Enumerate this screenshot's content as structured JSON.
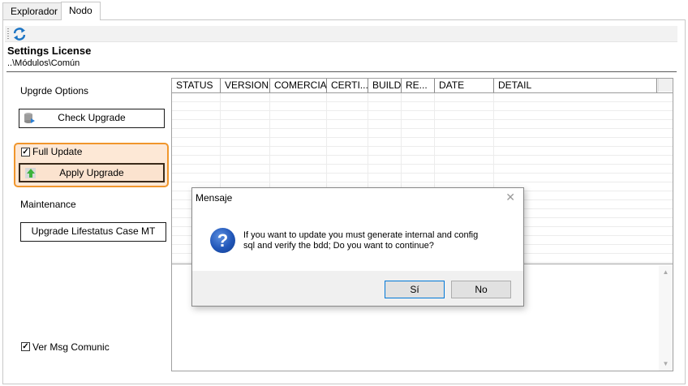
{
  "tabs": [
    {
      "label": "Explorador"
    },
    {
      "label": "Nodo"
    }
  ],
  "toolbar": {
    "refresh_icon": "refresh-icon"
  },
  "header": {
    "title": "Settings License",
    "path": "..\\Módulos\\Común"
  },
  "left_panel": {
    "upgrade_options_label": "Upgrde Options",
    "check_upgrade_label": "Check Upgrade",
    "full_update_label": "Full Update",
    "full_update_checked": true,
    "apply_upgrade_label": "Apply Upgrade",
    "maintenance_label": "Maintenance",
    "lifestatus_label": "Upgrade Lifestatus Case MT",
    "ver_msg_label": "Ver Msg Comunic",
    "ver_msg_checked": true
  },
  "grid": {
    "columns": [
      "STATUS",
      "VERSION",
      "COMERCIAL",
      "CERTI...",
      "BUILD",
      "RE...",
      "DATE",
      "DETAIL"
    ]
  },
  "dialog": {
    "title": "Mensaje",
    "message_line1": "If you want to update you must generate internal and config",
    "message_line2": "sql and verify the bdd;  Do you want to continue?",
    "yes_label": "Sí",
    "no_label": "No"
  },
  "colors": {
    "accent_orange": "#f0962c",
    "highlight_fill": "#fde8d6",
    "dialog_default_border": "#0078d7"
  }
}
